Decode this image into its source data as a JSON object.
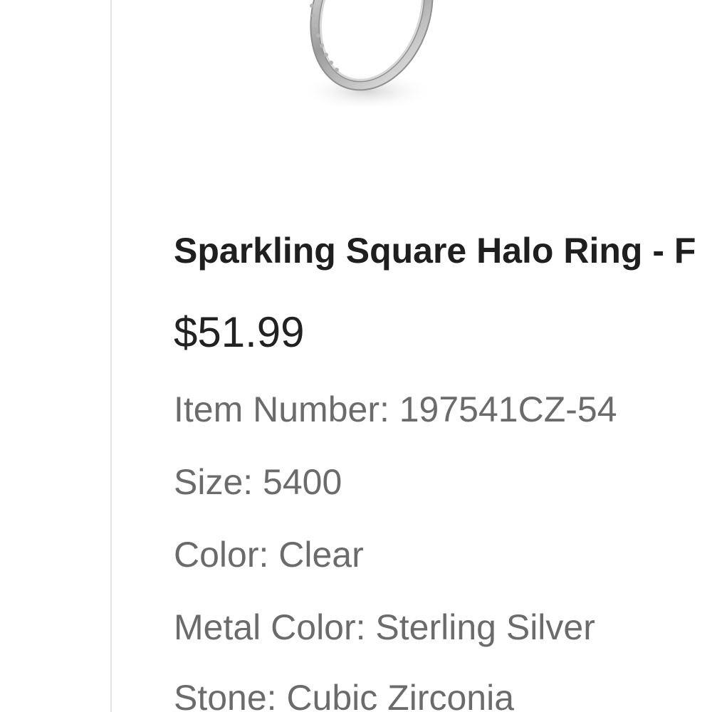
{
  "product": {
    "image_icon": "ring-photo",
    "title": "Sparkling Square Halo Ring - F",
    "price": "$51.99",
    "item_number": "Item Number: 197541CZ-54",
    "size": "Size: 5400",
    "color": "Color: Clear",
    "metal_color": "Metal Color: Sterling Silver",
    "stone": "Stone: Cubic Zirconia"
  }
}
